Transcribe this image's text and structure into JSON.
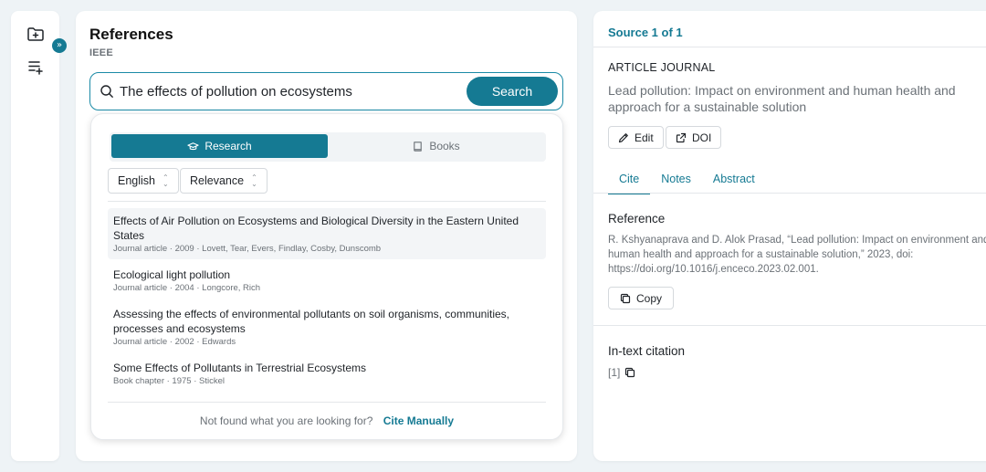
{
  "rail": {
    "icons": [
      "folder-plus-icon",
      "list-add-icon"
    ],
    "expand_glyph": "»"
  },
  "references": {
    "title": "References",
    "style": "IEEE",
    "search": {
      "value": "The effects of pollution on ecosystems",
      "button_label": "Search"
    },
    "segments": [
      {
        "label": "Research",
        "icon": "graduation-cap-icon",
        "active": true
      },
      {
        "label": "Books",
        "icon": "book-icon",
        "active": false
      }
    ],
    "filters": {
      "language": "English",
      "sort": "Relevance"
    },
    "results": [
      {
        "title": "Effects of Air Pollution on Ecosystems and Biological Diversity in the Eastern United States",
        "meta": "Journal article · 2009 · Lovett, Tear, Evers, Findlay, Cosby, Dunscomb"
      },
      {
        "title": "Ecological light pollution",
        "meta": "Journal article · 2004 · Longcore, Rich"
      },
      {
        "title": "Assessing the effects of environmental pollutants on soil organisms, communities, processes and ecosystems",
        "meta": "Journal article · 2002 · Edwards"
      },
      {
        "title": "Some Effects of Pollutants in Terrestrial Ecosystems",
        "meta": "Book chapter · 1975 · Stickel"
      }
    ],
    "footer": {
      "prompt": "Not found what you are looking for?",
      "link": "Cite Manually"
    }
  },
  "source": {
    "header": "Source 1 of 1",
    "type": "ARTICLE JOURNAL",
    "title": "Lead pollution: Impact on environment and human health and approach for a sustainable solution",
    "edit_label": "Edit",
    "doi_label": "DOI",
    "tabs": [
      {
        "label": "Cite",
        "active": true
      },
      {
        "label": "Notes",
        "active": false
      },
      {
        "label": "Abstract",
        "active": false
      }
    ],
    "reference_heading": "Reference",
    "reference_text": "R. Kshyanaprava and D. Alok Prasad, “Lead pollution: Impact on environment and human health and approach for a sustainable solution,” 2023, doi: https://doi.org/10.1016/j.enceco.2023.02.001.",
    "copy_label": "Copy",
    "intext_heading": "In-text citation",
    "intext_value": "[1]"
  },
  "colors": {
    "accent": "#157a93",
    "background": "#eef3f6"
  }
}
